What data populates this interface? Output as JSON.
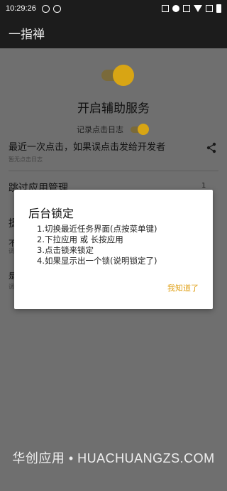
{
  "status_bar": {
    "time": "10:29:26",
    "icons": [
      "silent-icon",
      "circle-icon",
      "nfc-icon",
      "minus-circle-icon",
      "vibrate-icon",
      "wifi-icon",
      "no-sim-icon",
      "battery-icon"
    ]
  },
  "app_bar": {
    "title": "一指禅"
  },
  "service": {
    "title": "开启辅助服务",
    "log_label": "记录点击日志",
    "enabled": true
  },
  "last_click": {
    "label": "最近一次点击，如果误点击发给开发者",
    "empty_text": "暂无点击日志"
  },
  "skip_apps": {
    "label": "跳过应用管理",
    "count": "1"
  },
  "hidden_rows": {
    "a": "提",
    "b": "不",
    "c": "调",
    "d": "是",
    "e": "调"
  },
  "dialog": {
    "title": "后台锁定",
    "lines": [
      "1.切换最近任务界面(点按菜单键)",
      "2.下拉应用 或 长按应用",
      "3.点击锁来锁定",
      "4.如果显示出一个锁(说明锁定了)"
    ],
    "confirm": "我知道了"
  },
  "watermark": "华创应用 • HUACHUANGZS.COM",
  "colors": {
    "accent": "#d8a514",
    "dim_background": "#6f6f6f",
    "bar": "#1c1c1c"
  }
}
